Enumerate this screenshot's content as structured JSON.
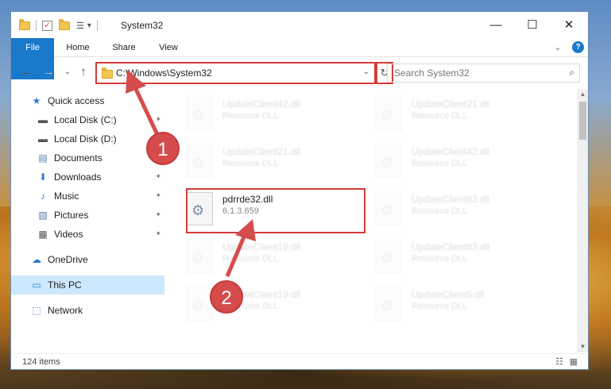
{
  "window": {
    "title": "System32"
  },
  "titlebar": {
    "minimize": "—",
    "maximize": "☐",
    "close": "✕",
    "dropdown": "▾"
  },
  "ribbon": {
    "tabs": [
      "File",
      "Home",
      "Share",
      "View"
    ],
    "expand": "⌄",
    "help": "?"
  },
  "address": {
    "path": "C:\\Windows\\System32",
    "dropdown": "⌄",
    "refresh": "↻"
  },
  "nav": {
    "back": "←",
    "forward": "→",
    "recent": "⌄",
    "up": "↑"
  },
  "search": {
    "placeholder": "Search System32",
    "icon": "⌕"
  },
  "sidebar": {
    "items": [
      {
        "label": "Quick access",
        "icon": "star-icon",
        "glyph": "★",
        "color": "#2c7cd6"
      },
      {
        "label": "Local Disk (C:)",
        "icon": "drive-icon",
        "glyph": "▬",
        "color": "#555"
      },
      {
        "label": "Local Disk (D:)",
        "icon": "drive-icon",
        "glyph": "▬",
        "color": "#555"
      },
      {
        "label": "Documents",
        "icon": "documents-icon",
        "glyph": "▤",
        "color": "#5a7fa8"
      },
      {
        "label": "Downloads",
        "icon": "download-icon",
        "glyph": "⬇",
        "color": "#2c7cd6"
      },
      {
        "label": "Music",
        "icon": "music-icon",
        "glyph": "♪",
        "color": "#2c7cd6"
      },
      {
        "label": "Pictures",
        "icon": "pictures-icon",
        "glyph": "▧",
        "color": "#5a7fa8"
      },
      {
        "label": "Videos",
        "icon": "videos-icon",
        "glyph": "▦",
        "color": "#555"
      },
      {
        "label": "OneDrive",
        "icon": "cloud-icon",
        "glyph": "☁",
        "color": "#2c7cd6"
      },
      {
        "label": "This PC",
        "icon": "computer-icon",
        "glyph": "▭",
        "color": "#2c7cd6"
      },
      {
        "label": "Network",
        "icon": "network-icon",
        "glyph": "⬚",
        "color": "#2c7cd6"
      }
    ],
    "pin": "📌"
  },
  "files": [
    {
      "name": "UpdateClient42.dll",
      "type": "Resource DLL"
    },
    {
      "name": "UpdateClient21.dll",
      "type": "Resource DLL"
    },
    {
      "name": "UpdateClient21.dll",
      "type": "Resource DLL"
    },
    {
      "name": "UpdateClient42.dll",
      "type": "Resource DLL"
    },
    {
      "name": "pdrrde32.dll",
      "type": "6.1.3.659"
    },
    {
      "name": "UpdateClient63.dll",
      "type": "Resource DLL"
    },
    {
      "name": "UpdateClient19.dll",
      "type": "Resource DLL"
    },
    {
      "name": "UpdateClient63.dll",
      "type": "Resource DLL"
    },
    {
      "name": "UpdateClient19.dll",
      "type": "Resource DLL"
    },
    {
      "name": "UpdateClient5.dll",
      "type": "Resource DLL"
    }
  ],
  "status": {
    "count": "124 items"
  },
  "callouts": [
    "1",
    "2"
  ],
  "colors": {
    "accent": "#1979ca",
    "highlight": "#d43b3b",
    "selected": "#cce8ff"
  }
}
